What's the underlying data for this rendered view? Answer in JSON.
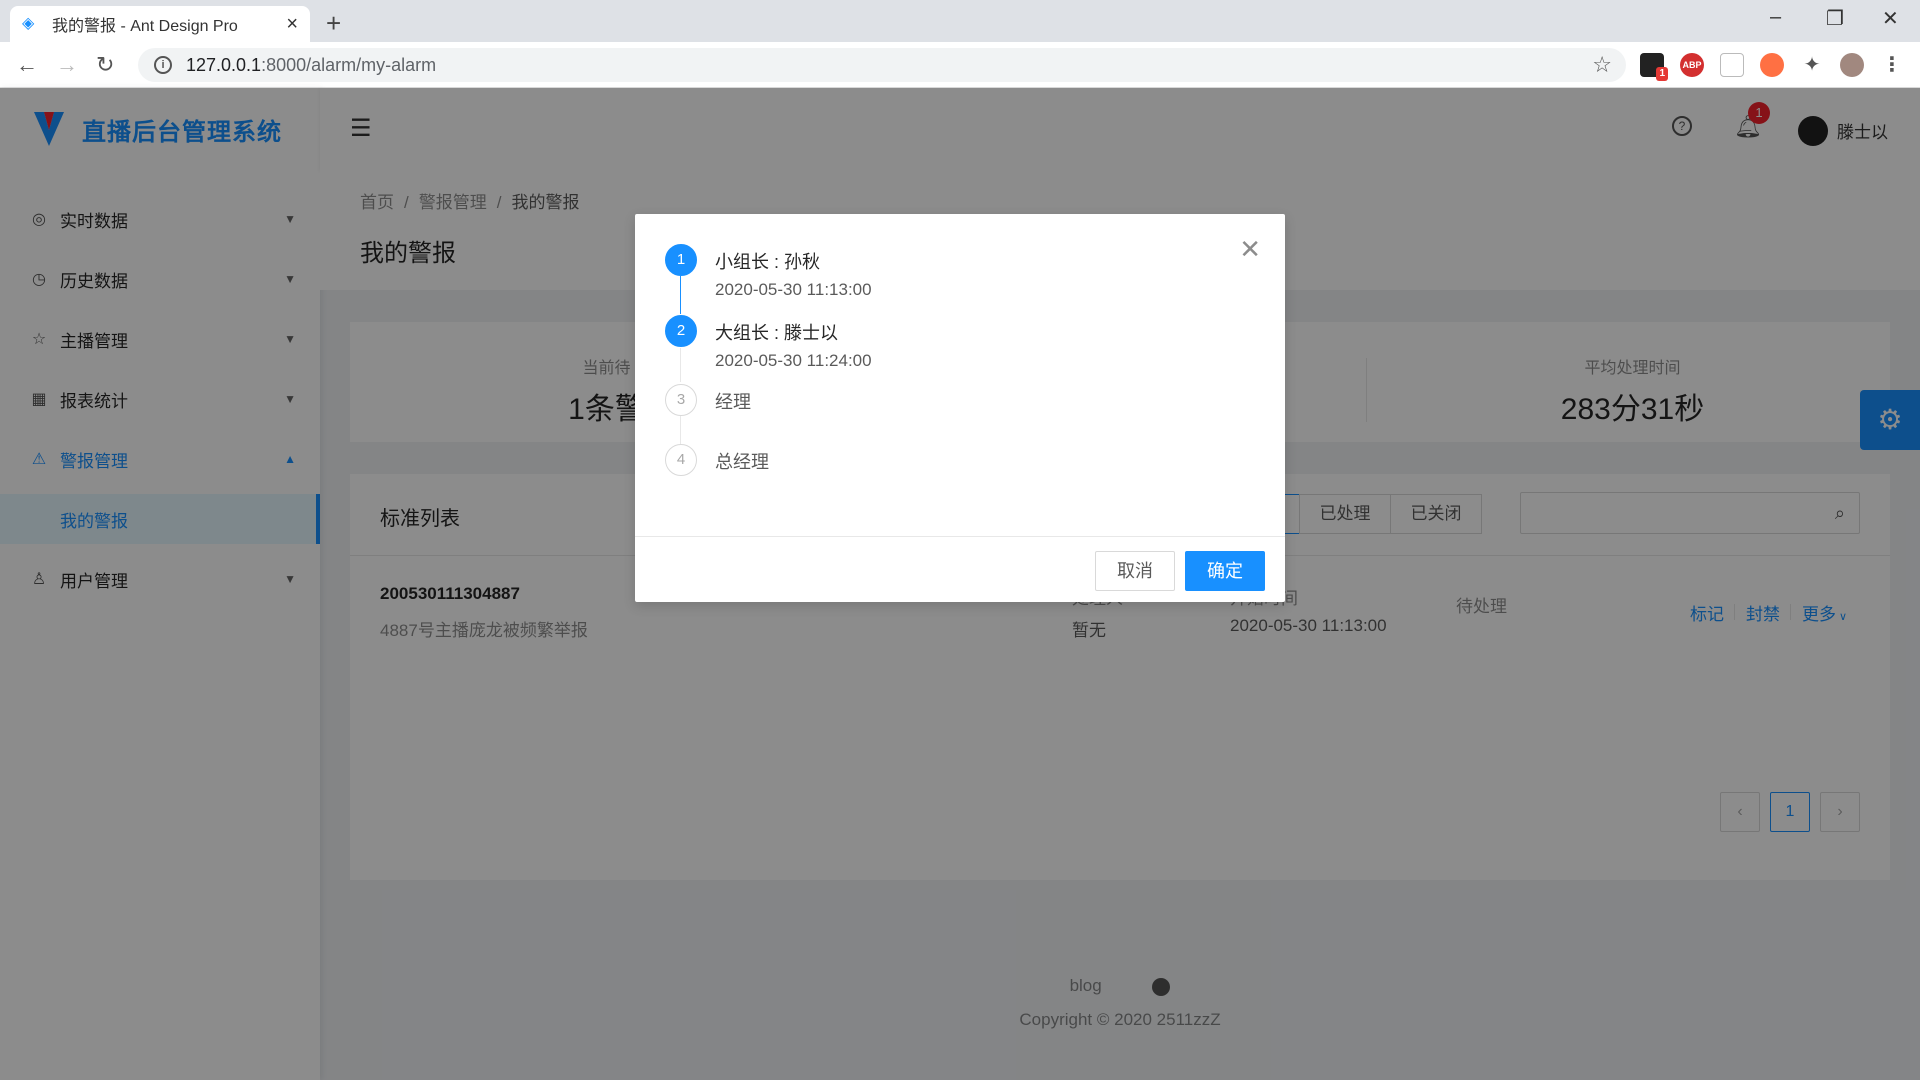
{
  "browser": {
    "tab_title": "我的警报 - Ant Design Pro",
    "url_host": "127.0.0.1",
    "url_rest": ":8000/alarm/my-alarm",
    "ext_abp": "ABP",
    "ext_badge": "1"
  },
  "app": {
    "name": "直播后台管理系统"
  },
  "sidebar": {
    "items": [
      {
        "label": "实时数据",
        "icon": "dashboard-icon"
      },
      {
        "label": "历史数据",
        "icon": "history-icon"
      },
      {
        "label": "主播管理",
        "icon": "star-icon"
      },
      {
        "label": "报表统计",
        "icon": "table-icon"
      },
      {
        "label": "警报管理",
        "icon": "warning-icon"
      },
      {
        "label": "用户管理",
        "icon": "user-icon"
      }
    ],
    "sub_item": "我的警报"
  },
  "header": {
    "notification_count": "1",
    "username": "滕士以"
  },
  "page": {
    "breadcrumb": [
      "首页",
      "警报管理",
      "我的警报"
    ],
    "title": "我的警报"
  },
  "stats": {
    "left_label": "当前待",
    "left_value": "1条警",
    "right_label": "平均处理时间",
    "right_value": "283分31秒"
  },
  "list": {
    "title": "标准列表",
    "filters": [
      "理",
      "已处理",
      "已关闭"
    ],
    "row": {
      "code": "200530111304887",
      "description": "4887号主播庞龙被频繁举报",
      "handler_label": "处理人",
      "handler_value": "暂无",
      "start_label": "开始时间",
      "start_value": "2020-05-30 11:13:00",
      "status": "待处理",
      "actions": [
        "标记",
        "封禁",
        "更多"
      ]
    },
    "pagination": {
      "current": "1"
    }
  },
  "footer": {
    "link": "blog",
    "copyright": "Copyright © 2020 2511zzZ"
  },
  "modal": {
    "steps": [
      {
        "num": "1",
        "title": "小组长 : 孙秋",
        "time": "2020-05-30 11:13:00",
        "status": "done"
      },
      {
        "num": "2",
        "title": "大组长 : 滕士以",
        "time": "2020-05-30 11:24:00",
        "status": "done"
      },
      {
        "num": "3",
        "title": "经理",
        "status": "wait"
      },
      {
        "num": "4",
        "title": "总经理",
        "status": "wait"
      }
    ],
    "cancel_label": "取消",
    "ok_label": "确定"
  },
  "colors": {
    "primary": "#1890ff",
    "danger": "#f5222d"
  }
}
